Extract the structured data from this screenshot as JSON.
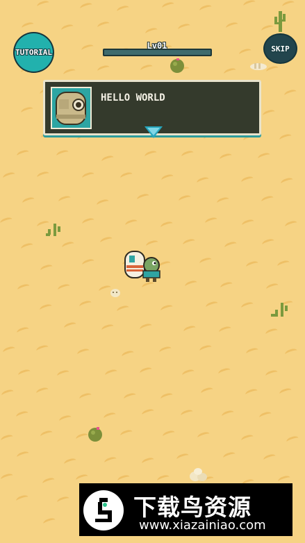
{
  "hud": {
    "tutorial_label": "TUTORIAL",
    "skip_label": "SKIP",
    "level_label": "Lv01",
    "xp_progress": 0.0
  },
  "dialog": {
    "text": "HELLO WORLD"
  },
  "watermark": {
    "title": "下载鸟资源",
    "url": "www.xiazainiao.com"
  },
  "colors": {
    "sand": "#f6d384",
    "sand_wave": "#eebe63",
    "teal": "#22b1ad",
    "dark_teal": "#22454d",
    "dialog_bg": "#343a2c"
  }
}
